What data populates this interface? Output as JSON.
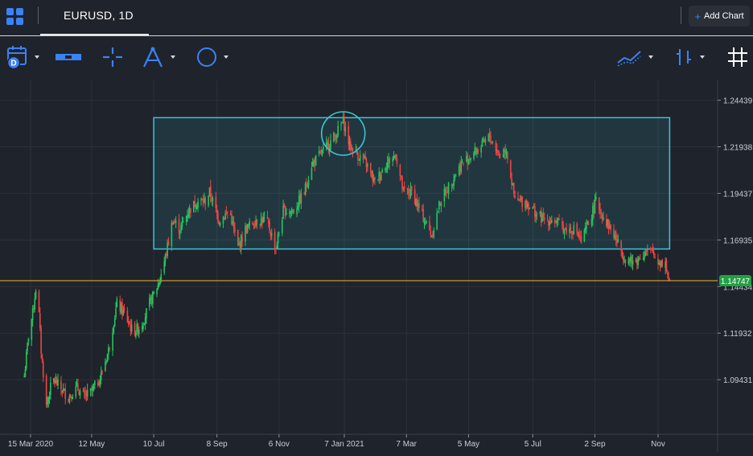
{
  "header": {
    "symbol": "EURUSD, 1D",
    "add_chart_label": "Add Chart"
  },
  "toolbar": {
    "tools": [
      "calendar-icon",
      "measure-icon",
      "crosshair-icon",
      "fibonacci-icon",
      "ellipse-icon",
      "indicators-icon",
      "bar-type-icon",
      "grid-icon"
    ]
  },
  "colors": {
    "background": "#1f232b",
    "up_candle": "#22c55e",
    "down_candle": "#ef4444",
    "rectangle": "#3cc4d8",
    "price_line": "#c79a2f",
    "price_badge": "#22a043",
    "toolbar_icon": "#3b82f6"
  },
  "chart_data": {
    "type": "candlestick",
    "x_ticks": [
      "15 Mar 2020",
      "12 May",
      "10 Jul",
      "8 Sep",
      "6 Nov",
      "7 Jan 2021",
      "7 Mar",
      "5 May",
      "5 Jul",
      "2 Sep",
      "Nov"
    ],
    "y_ticks": [
      "1.24439",
      "1.21938",
      "1.19437",
      "1.16935",
      "1.14434",
      "1.11932",
      "1.09431"
    ],
    "ylim": [
      1.065,
      1.255
    ],
    "current_price": "1.14747",
    "annotations": {
      "rectangle": {
        "x_start": "2020-07-10",
        "x_end": "2021-11-12",
        "y_low": 1.1645,
        "y_high": 1.235
      },
      "circle": {
        "x_center": "2021-01-06",
        "y_center": 1.2265
      }
    },
    "series": [
      {
        "values": [
          {
            "x": "2020-03-09",
            "y": 1.096
          },
          {
            "x": "2020-03-13",
            "y": 1.118
          },
          {
            "x": "2020-03-17",
            "y": 1.13
          },
          {
            "x": "2020-03-21",
            "y": 1.148
          },
          {
            "x": "2020-03-25",
            "y": 1.11
          },
          {
            "x": "2020-03-30",
            "y": 1.08
          },
          {
            "x": "2020-04-05",
            "y": 1.095
          },
          {
            "x": "2020-04-12",
            "y": 1.09
          },
          {
            "x": "2020-04-20",
            "y": 1.085
          },
          {
            "x": "2020-04-28",
            "y": 1.09
          },
          {
            "x": "2020-05-05",
            "y": 1.085
          },
          {
            "x": "2020-05-12",
            "y": 1.088
          },
          {
            "x": "2020-05-20",
            "y": 1.095
          },
          {
            "x": "2020-05-28",
            "y": 1.11
          },
          {
            "x": "2020-06-05",
            "y": 1.135
          },
          {
            "x": "2020-06-12",
            "y": 1.13
          },
          {
            "x": "2020-06-20",
            "y": 1.12
          },
          {
            "x": "2020-06-28",
            "y": 1.123
          },
          {
            "x": "2020-07-06",
            "y": 1.135
          },
          {
            "x": "2020-07-14",
            "y": 1.145
          },
          {
            "x": "2020-07-21",
            "y": 1.16
          },
          {
            "x": "2020-07-28",
            "y": 1.18
          },
          {
            "x": "2020-08-04",
            "y": 1.175
          },
          {
            "x": "2020-08-12",
            "y": 1.185
          },
          {
            "x": "2020-08-20",
            "y": 1.19
          },
          {
            "x": "2020-08-28",
            "y": 1.19
          },
          {
            "x": "2020-09-01",
            "y": 1.195
          },
          {
            "x": "2020-09-10",
            "y": 1.18
          },
          {
            "x": "2020-09-20",
            "y": 1.185
          },
          {
            "x": "2020-09-28",
            "y": 1.165
          },
          {
            "x": "2020-10-05",
            "y": 1.175
          },
          {
            "x": "2020-10-15",
            "y": 1.18
          },
          {
            "x": "2020-10-25",
            "y": 1.18
          },
          {
            "x": "2020-11-03",
            "y": 1.165
          },
          {
            "x": "2020-11-10",
            "y": 1.185
          },
          {
            "x": "2020-11-20",
            "y": 1.185
          },
          {
            "x": "2020-11-30",
            "y": 1.195
          },
          {
            "x": "2020-12-07",
            "y": 1.21
          },
          {
            "x": "2020-12-15",
            "y": 1.215
          },
          {
            "x": "2020-12-22",
            "y": 1.22
          },
          {
            "x": "2020-12-29",
            "y": 1.225
          },
          {
            "x": "2021-01-06",
            "y": 1.233
          },
          {
            "x": "2021-01-12",
            "y": 1.22
          },
          {
            "x": "2021-01-20",
            "y": 1.215
          },
          {
            "x": "2021-01-28",
            "y": 1.21
          },
          {
            "x": "2021-02-05",
            "y": 1.2
          },
          {
            "x": "2021-02-15",
            "y": 1.21
          },
          {
            "x": "2021-02-25",
            "y": 1.215
          },
          {
            "x": "2021-03-04",
            "y": 1.195
          },
          {
            "x": "2021-03-12",
            "y": 1.195
          },
          {
            "x": "2021-03-20",
            "y": 1.185
          },
          {
            "x": "2021-03-31",
            "y": 1.172
          },
          {
            "x": "2021-04-08",
            "y": 1.19
          },
          {
            "x": "2021-04-18",
            "y": 1.2
          },
          {
            "x": "2021-04-28",
            "y": 1.21
          },
          {
            "x": "2021-05-08",
            "y": 1.215
          },
          {
            "x": "2021-05-18",
            "y": 1.22
          },
          {
            "x": "2021-05-25",
            "y": 1.225
          },
          {
            "x": "2021-06-03",
            "y": 1.215
          },
          {
            "x": "2021-06-10",
            "y": 1.218
          },
          {
            "x": "2021-06-18",
            "y": 1.19
          },
          {
            "x": "2021-06-28",
            "y": 1.19
          },
          {
            "x": "2021-07-06",
            "y": 1.185
          },
          {
            "x": "2021-07-15",
            "y": 1.18
          },
          {
            "x": "2021-07-25",
            "y": 1.18
          },
          {
            "x": "2021-08-05",
            "y": 1.175
          },
          {
            "x": "2021-08-15",
            "y": 1.175
          },
          {
            "x": "2021-08-20",
            "y": 1.168
          },
          {
            "x": "2021-08-28",
            "y": 1.18
          },
          {
            "x": "2021-09-03",
            "y": 1.19
          },
          {
            "x": "2021-09-10",
            "y": 1.182
          },
          {
            "x": "2021-09-20",
            "y": 1.172
          },
          {
            "x": "2021-09-30",
            "y": 1.16
          },
          {
            "x": "2021-10-08",
            "y": 1.157
          },
          {
            "x": "2021-10-18",
            "y": 1.162
          },
          {
            "x": "2021-10-26",
            "y": 1.163
          },
          {
            "x": "2021-11-01",
            "y": 1.158
          },
          {
            "x": "2021-11-08",
            "y": 1.157
          },
          {
            "x": "2021-11-12",
            "y": 1.145
          }
        ]
      }
    ]
  }
}
